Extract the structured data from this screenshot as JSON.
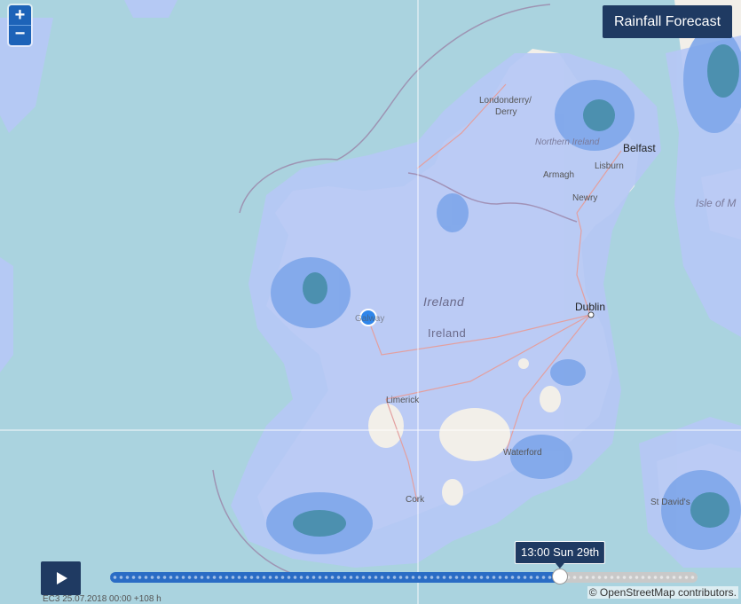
{
  "title_button": "Rainfall Forecast",
  "zoom": {
    "in_label": "+",
    "out_label": "−"
  },
  "timeline": {
    "current_label": "13:00 Sun 29th",
    "progress": 0.766
  },
  "model_run": "EC3 25.07.2018 00:00 +108 h",
  "attribution": "© OpenStreetMap contributors.",
  "labels": {
    "country_1": "Ireland",
    "country_2": "Ireland",
    "northern_ireland": "Northern Ireland",
    "isle_of_man": "Isle of M",
    "londonderry": "Londonderry/",
    "derry": "Derry",
    "belfast": "Belfast",
    "lisburn": "Lisburn",
    "armagh": "Armagh",
    "newry": "Newry",
    "dublin": "Dublin",
    "galway": "Galway",
    "limerick": "Limerick",
    "waterford": "Waterford",
    "cork": "Cork",
    "st_davids": "St David's"
  },
  "colors": {
    "sea": "#aad3df",
    "rain_light": "#b6c8f5",
    "rain_medium": "#7ea6ea",
    "rain_heavy": "#4f8ad8",
    "panel": "#1f3a62"
  },
  "icons": {
    "play": "play-icon",
    "location": "location-marker-icon"
  }
}
